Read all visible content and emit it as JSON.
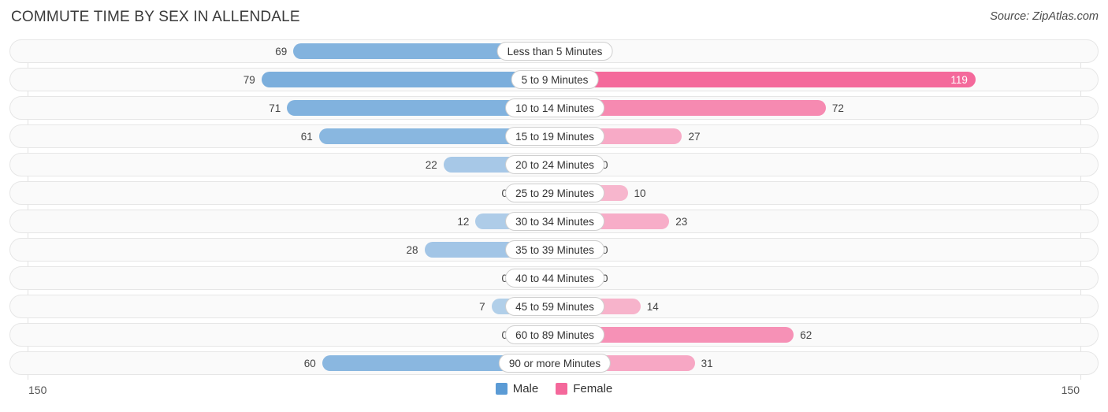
{
  "header": {
    "title": "COMMUTE TIME BY SEX IN ALLENDALE",
    "source": "Source: ZipAtlas.com"
  },
  "legend": {
    "male_label": "Male",
    "female_label": "Female",
    "male_color": "#5b9bd5",
    "female_color": "#f4689b"
  },
  "axis": {
    "left_label": "150",
    "right_label": "150"
  },
  "chart_data": {
    "type": "bar",
    "orientation": "horizontal-diverging",
    "title": "COMMUTE TIME BY SEX IN ALLENDALE",
    "subtitle": "",
    "xlabel": "",
    "ylabel": "",
    "axis_max": 150,
    "xlim": [
      -150,
      150
    ],
    "grid": true,
    "legend_position": "bottom-center",
    "categories": [
      "Less than 5 Minutes",
      "5 to 9 Minutes",
      "10 to 14 Minutes",
      "15 to 19 Minutes",
      "20 to 24 Minutes",
      "25 to 29 Minutes",
      "30 to 34 Minutes",
      "35 to 39 Minutes",
      "40 to 44 Minutes",
      "45 to 59 Minutes",
      "60 to 89 Minutes",
      "90 or more Minutes"
    ],
    "series": [
      {
        "name": "Male",
        "color": "#5b9bd5",
        "direction": "left",
        "values": [
          69,
          79,
          71,
          61,
          22,
          0,
          12,
          28,
          0,
          7,
          0,
          60
        ]
      },
      {
        "name": "Female",
        "color": "#f4689b",
        "direction": "right",
        "values": [
          0,
          119,
          72,
          27,
          0,
          10,
          23,
          0,
          0,
          14,
          62,
          31
        ]
      }
    ]
  }
}
